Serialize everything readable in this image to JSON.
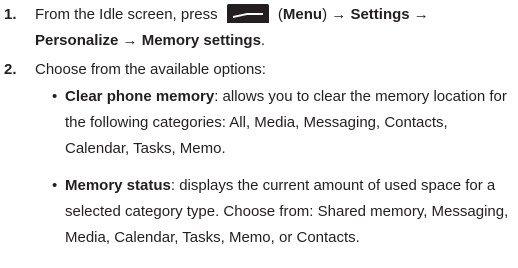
{
  "steps": [
    {
      "number": "1.",
      "text_before_icon": "From the Idle screen, press",
      "menu_key_label": "(Menu)",
      "arrow": "→",
      "path_1": "Settings",
      "path_2": "Personalize",
      "path_3": "Memory settings",
      "end": "."
    },
    {
      "number": "2.",
      "text": "Choose from the available options:"
    }
  ],
  "options": [
    {
      "bullet": "•",
      "title": "Clear phone memory",
      "description": ": allows you to clear the memory location for the following categories: All, Media, Messaging, Contacts, Calendar, Tasks, Memo."
    },
    {
      "bullet": "•",
      "title": "Memory status",
      "description": ": displays the current amount of used space for a selected category type. Choose from: Shared memory, Messaging, Media, Calendar, Tasks, Memo, or Contacts."
    }
  ],
  "icons": {
    "menu_key": "soft-key-icon",
    "menu_key_color": "#231f20"
  }
}
